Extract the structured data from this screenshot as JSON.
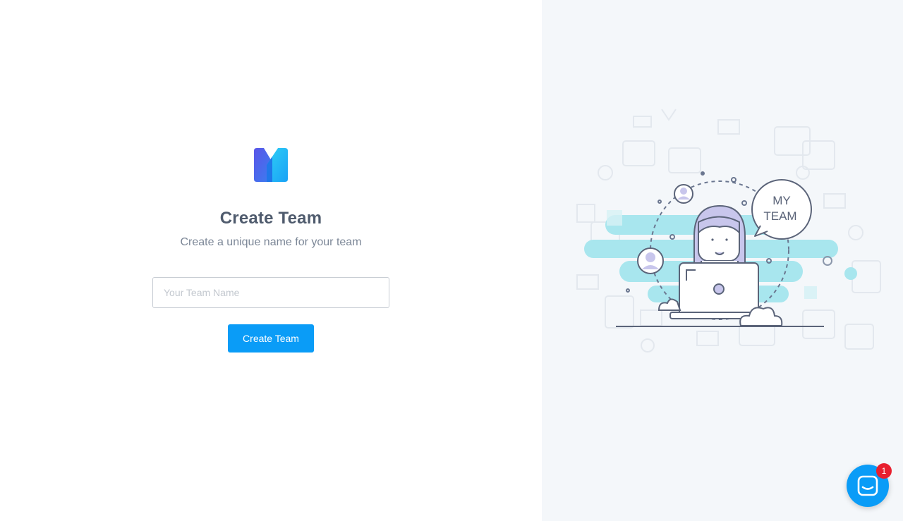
{
  "brand": {
    "logo_icon": "brand-logo-icon",
    "accent_color": "#0a9cf7"
  },
  "form": {
    "title": "Create Team",
    "subtitle": "Create a unique name for your team",
    "team_name_placeholder": "Your Team Name",
    "team_name_value": "",
    "submit_label": "Create Team"
  },
  "illustration": {
    "bubble_line1": "MY",
    "bubble_line2": "TEAM"
  },
  "chat": {
    "icon": "chat-icon",
    "unread_count": "1",
    "badge_color": "#e8202f"
  }
}
